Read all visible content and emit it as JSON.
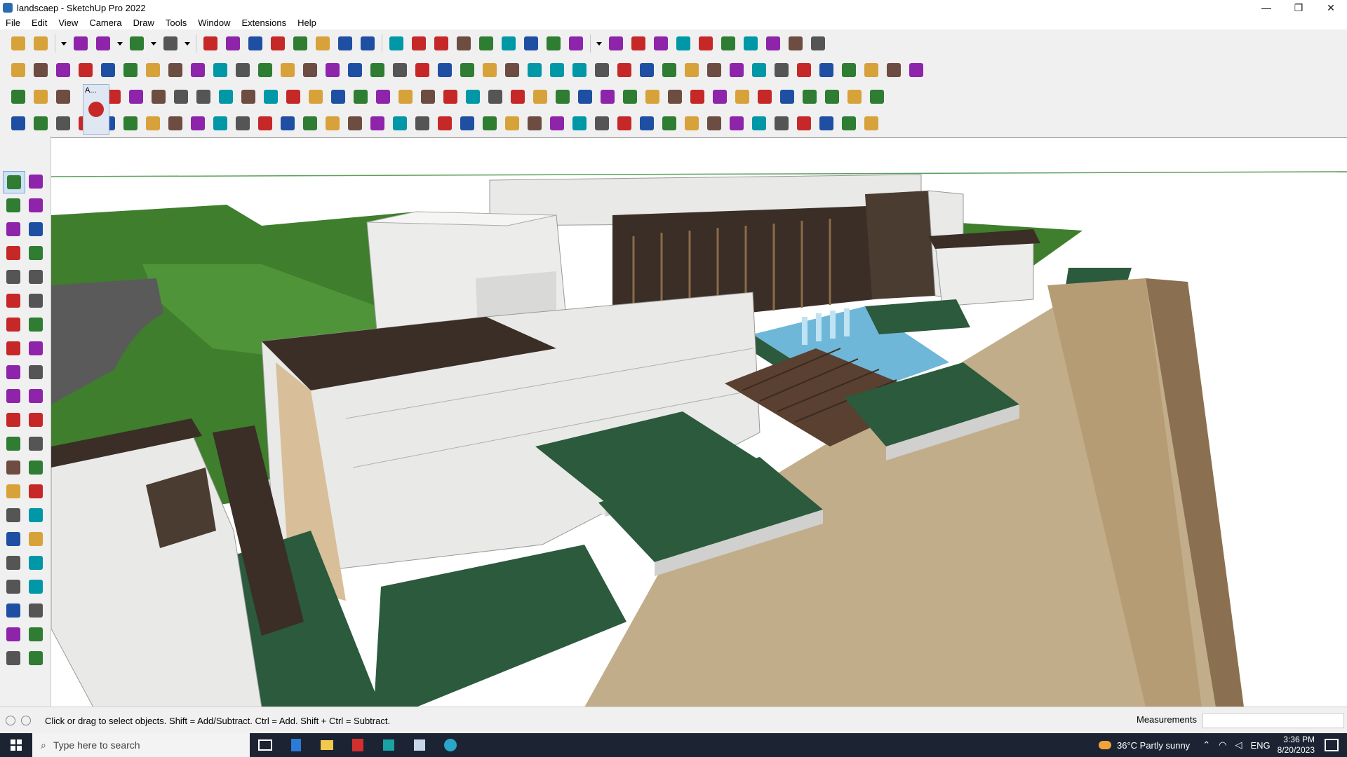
{
  "window": {
    "title": "landscaep - SketchUp Pro 2022",
    "controls": {
      "minimize": "—",
      "restore": "❐",
      "close": "✕"
    }
  },
  "menu": [
    "File",
    "Edit",
    "View",
    "Camera",
    "Draw",
    "Tools",
    "Window",
    "Extensions",
    "Help"
  ],
  "toolbar_rows": [
    {
      "icons": [
        "zoom-icon",
        "select-icon",
        "dropdown-icon",
        "eraser-icon",
        "pencil-icon",
        "dropdown-icon",
        "lasso-icon",
        "dropdown-icon",
        "rectangle-icon",
        "dropdown-icon",
        "push-pull-icon",
        "follow-me-icon",
        "move-icon",
        "rotate-icon",
        "scale-icon",
        "tape-icon",
        "text-icon",
        "paint-icon",
        "orbit-icon",
        "walk-icon",
        "zoom-window-icon",
        "zoom-extents-icon",
        "layers-icon",
        "sandbox-icon",
        "section-icon",
        "sandbox-tools-icon",
        "user-icon",
        "dropdown-icon",
        "component-icon",
        "warehouse-icon",
        "extension-icon",
        "up-arrow-icon",
        "down-arrow-icon",
        "axes-icon",
        "xray-icon",
        "undo-icon",
        "redo-icon",
        "fingerprint-icon"
      ]
    },
    {
      "icons": [
        "box-icon",
        "box-icon",
        "box-icon",
        "arrow-in-icon",
        "arrow-icon",
        "arrow-icon",
        "arrow-icon",
        "arrow-icon",
        "arrow-icon",
        "arrow-icon",
        "arrow-icon",
        "curve-icon",
        "parallel-icon",
        "parallel-icon",
        "parallel-icon",
        "plane-icon",
        "plane-icon",
        "house-icon",
        "house-icon",
        "house-icon",
        "house-icon",
        "house-icon",
        "function-icon",
        "hand-icon",
        "wand-icon",
        "shape-icon",
        "shape-icon",
        "shape-icon",
        "shape-icon",
        "shape-icon",
        "shape-icon",
        "shape-icon",
        "shape-icon",
        "shape-icon",
        "shape-icon",
        "shape-icon",
        "shape-icon",
        "shape-icon",
        "shape-icon",
        "shape-icon",
        "shape-icon"
      ]
    },
    {
      "icons": [
        "plane-icon",
        "plane-icon",
        "plane-icon",
        "text-style-icon",
        "frame-icon",
        "rotate-arrow-icon",
        "square-icon",
        "grid-icon",
        "window-icon",
        "box-icon",
        "link-icon",
        "bend-icon",
        "curve-icon",
        "plus-icon",
        "plus-icon",
        "cross-icon",
        "cone-icon",
        "cone-icon",
        "triangle-icon",
        "c-icon",
        "c-icon",
        "c-icon",
        "move-icon",
        "box-icon",
        "u-turn-icon",
        "b-icon",
        "puzzle-icon",
        "puzzle-icon",
        "puzzle-icon",
        "box-icon",
        "gear-icon",
        "layers-icon",
        "grid-icon",
        "grid-icon",
        "grid-icon",
        "scissors-icon",
        "curve-icon",
        "qr-icon"
      ]
    },
    {
      "icons": [
        "path-icon",
        "path-icon",
        "shape-icon",
        "shape-icon",
        "shape-icon",
        "shape-icon",
        "shape-icon",
        "shape-icon",
        "shape-icon",
        "shape-icon",
        "shape-icon",
        "shape-icon",
        "shape-icon",
        "shape-icon",
        "shape-icon",
        "shape-icon",
        "shape-icon",
        "shape-icon",
        "shape-icon",
        "shape-icon",
        "shape-icon",
        "shape-icon",
        "shape-icon",
        "shape-icon",
        "shape-icon",
        "shape-icon",
        "shape-icon",
        "shape-icon",
        "shape-icon",
        "shape-icon",
        "shape-icon",
        "shape-icon",
        "shape-icon",
        "shape-icon",
        "shape-icon",
        "shape-icon",
        "shape-icon",
        "shape-icon",
        "shape-icon"
      ]
    }
  ],
  "active_style_label": "A...",
  "status": {
    "hint": "Click or drag to select objects. Shift = Add/Subtract. Ctrl = Add. Shift + Ctrl = Subtract.",
    "measurements_label": "Measurements"
  },
  "taskbar": {
    "search_placeholder": "Type here to search",
    "weather": "36°C  Partly sunny",
    "lang": "ENG",
    "time": "3:36 PM",
    "date": "8/20/2023"
  },
  "colors": {
    "sky": "#ffffff",
    "grass": "#3d7a2a",
    "paving": "#c2ad8a",
    "stone": "#e9e9e7",
    "dark": "#3a2e26",
    "hedge": "#2b5a3c",
    "water": "#6fb7d8",
    "accent": "#c62828"
  }
}
